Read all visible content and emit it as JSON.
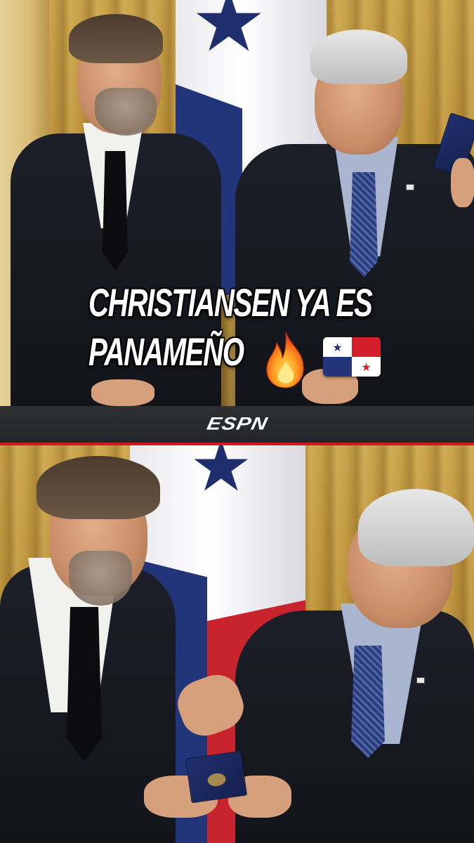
{
  "headline": {
    "line1": "CHRISTIANSEN YA ES",
    "line2": "PANAMEÑO"
  },
  "emojis": {
    "fire": "fire-emoji",
    "flag": "panama-flag-emoji"
  },
  "brand": {
    "logo_text": "ESPN",
    "bar_color": "#2a2b2d",
    "accent_color": "#d0191f"
  },
  "photos": {
    "top": "two-men-posing-with-panama-flag",
    "bottom": "passport-handover-ceremony"
  },
  "colors": {
    "flag_blue": "#22357a",
    "flag_red": "#c8242e",
    "curtain_gold": "#c9a24a"
  }
}
